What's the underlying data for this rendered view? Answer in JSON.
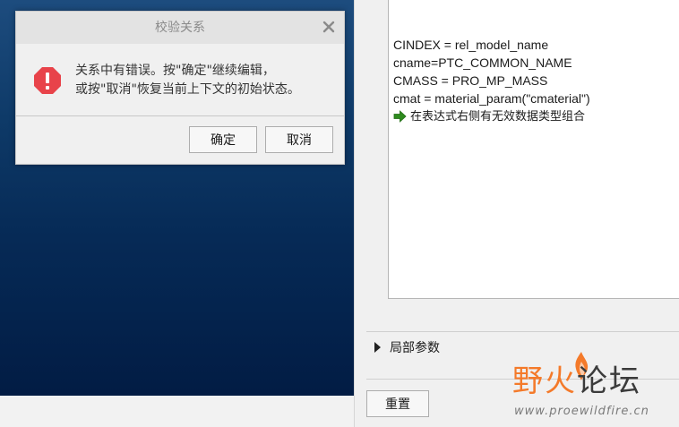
{
  "dialog": {
    "title": "校验关系",
    "message_line1": "关系中有错误。按\"确定\"继续编辑，",
    "message_line2": "或按\"取消\"恢复当前上下文的初始状态。",
    "ok_label": "确定",
    "cancel_label": "取消"
  },
  "editor": {
    "lines": [
      "CINDEX = rel_model_name",
      "cname=PTC_COMMON_NAME",
      "CMASS = PRO_MP_MASS",
      "cmat = material_param(\"cmaterial\")"
    ],
    "error_message": "在表达式右侧有无效数据类型组合"
  },
  "local_params": {
    "label": "局部参数"
  },
  "reset_label": "重置",
  "watermark": {
    "title_part1": "野火",
    "title_part2": "论坛",
    "url": "www.proewildfire.cn"
  },
  "colors": {
    "error_red": "#e8434a",
    "arrow_green": "#2e8b1e",
    "watermark_orange": "#f47a2a"
  }
}
